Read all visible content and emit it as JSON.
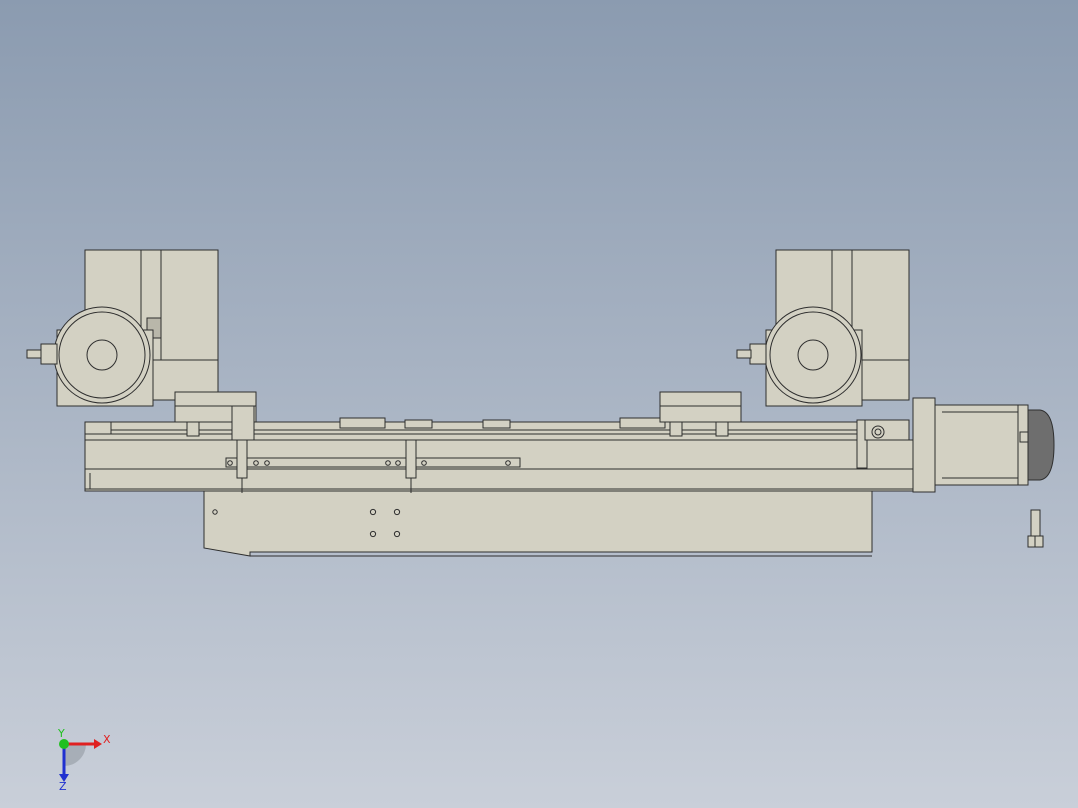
{
  "viewport": {
    "background_top": "#8b9bb0",
    "background_bottom": "#c9cfd9"
  },
  "model": {
    "part_fill": "#d3d1c3",
    "part_fill_dark": "#b9b7aa",
    "edge_color": "#2e2e2e",
    "motor_cap_color": "#6e6e6e",
    "components": [
      "left-drive-assembly",
      "right-drive-assembly",
      "linear-rail-carriage",
      "base-plate",
      "servo-motor",
      "hex-bolt"
    ]
  },
  "triad": {
    "x_label": "X",
    "z_label": "Z",
    "y_label": "Y",
    "x_color": "#e02020",
    "y_color": "#20c020",
    "z_color": "#2030d0"
  }
}
